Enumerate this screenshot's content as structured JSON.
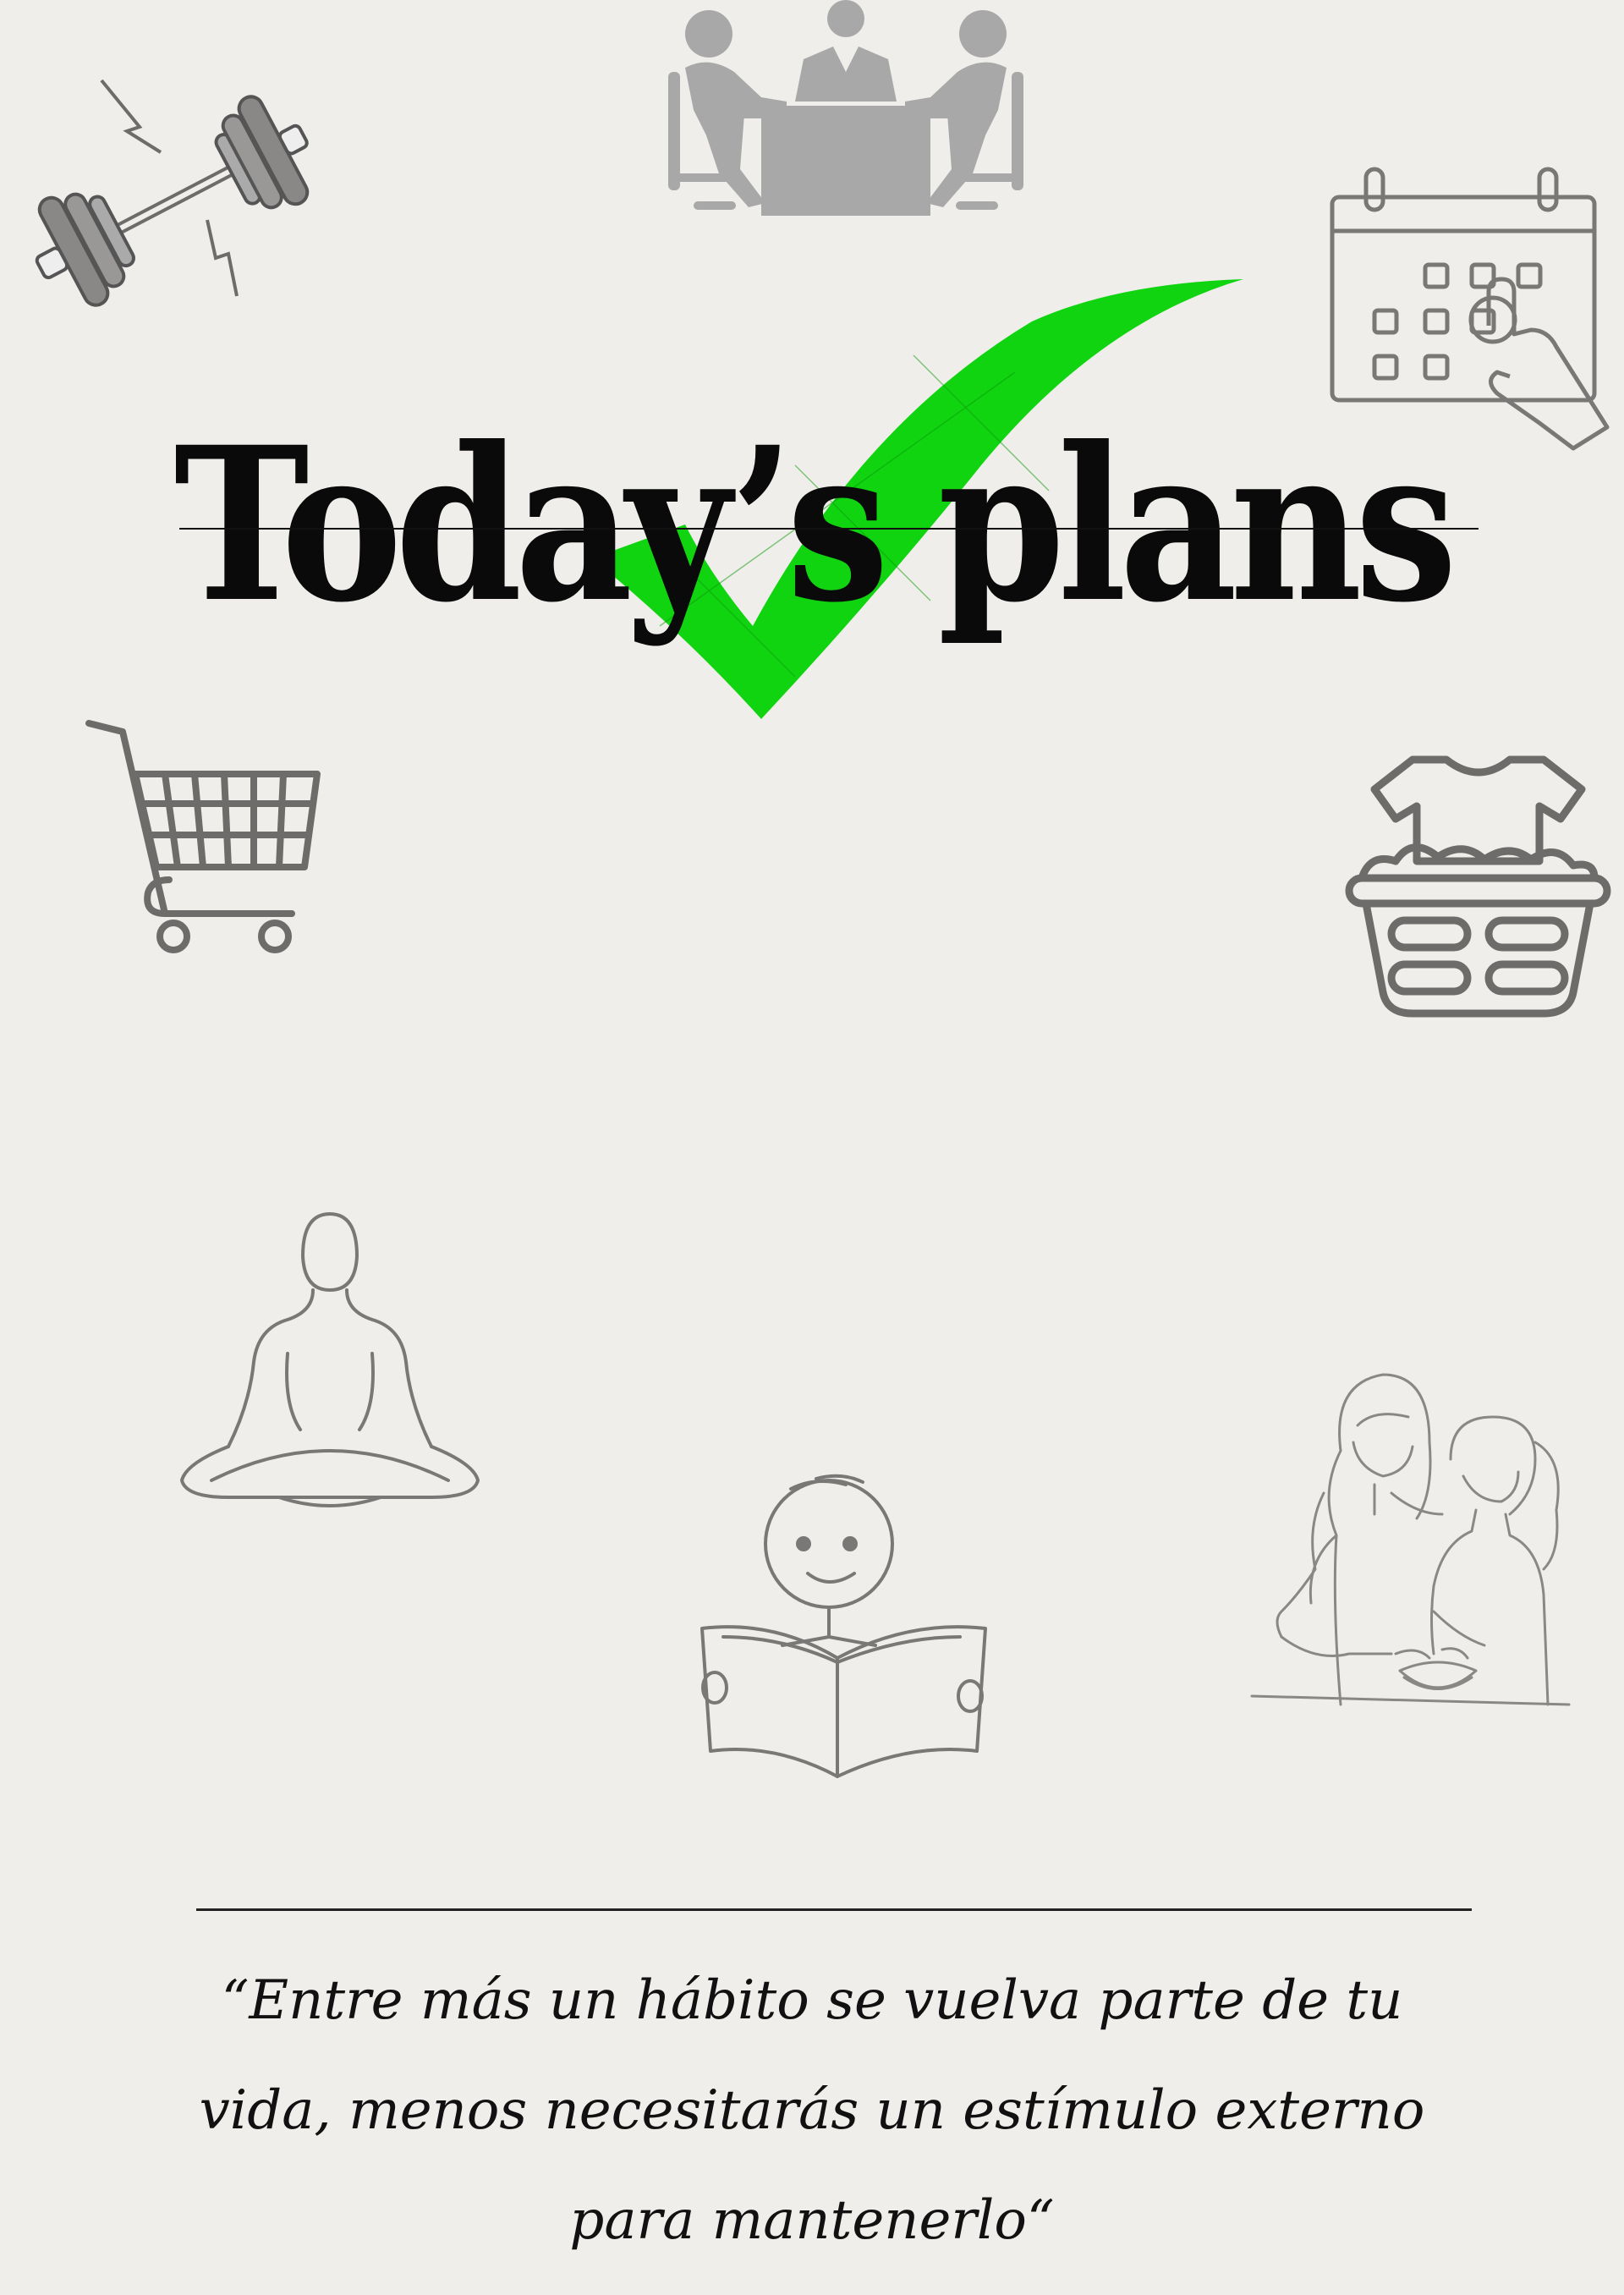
{
  "title": "Today’s plans",
  "quote": "“Entre más un hábito se vuelva parte de tu vida, menos necesitarás un estímulo externo para mantenerlo“",
  "colors": {
    "background": "#f0eeeb",
    "check": "#11d411",
    "icon_stroke": "#6e6c6a",
    "icon_fill_light": "#a8a8a8"
  },
  "icons": [
    "dumbbell-icon",
    "meeting-icon",
    "calendar-icon",
    "shopping-cart-icon",
    "laundry-basket-icon",
    "meditation-icon",
    "reading-child-icon",
    "mother-daughter-cooking-icon"
  ]
}
